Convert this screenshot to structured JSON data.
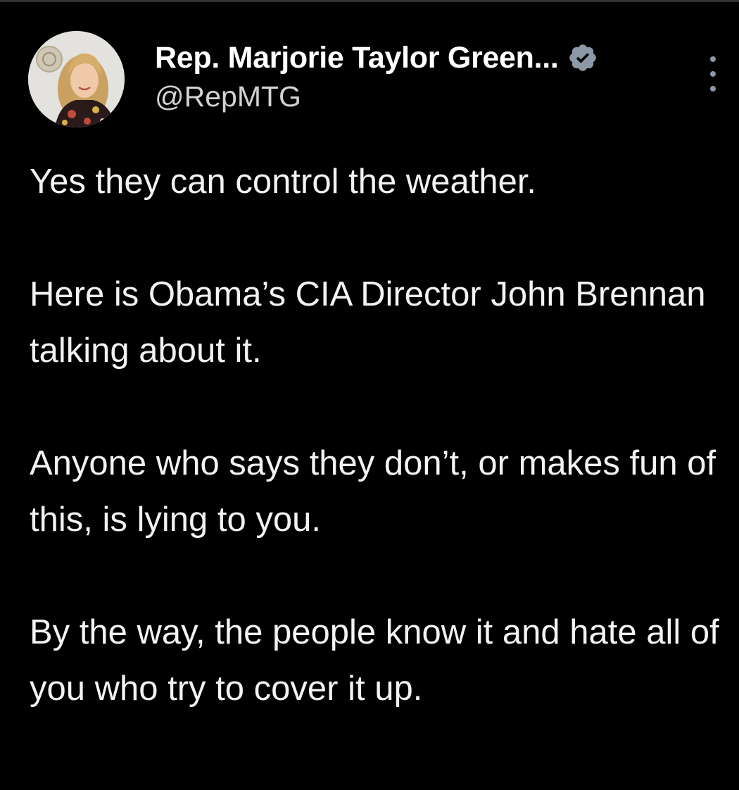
{
  "tweet": {
    "author": {
      "display_name": "Rep. Marjorie Taylor Green...",
      "handle": "@RepMTG",
      "verified": true,
      "verified_color": "#8b98a5",
      "avatar": "profile-photo"
    },
    "more_icon": "more-options-vertical-icon",
    "paragraphs": [
      "Yes they can control the weather.",
      "Here is Obama’s CIA Director John Brennan talking about it.",
      "Anyone who says they don’t, or makes fun of this, is lying to you.",
      "By the way, the people know it and hate all of you who try to cover it up."
    ]
  },
  "theme": {
    "background": "#000000",
    "text": "#e7e9ea"
  }
}
